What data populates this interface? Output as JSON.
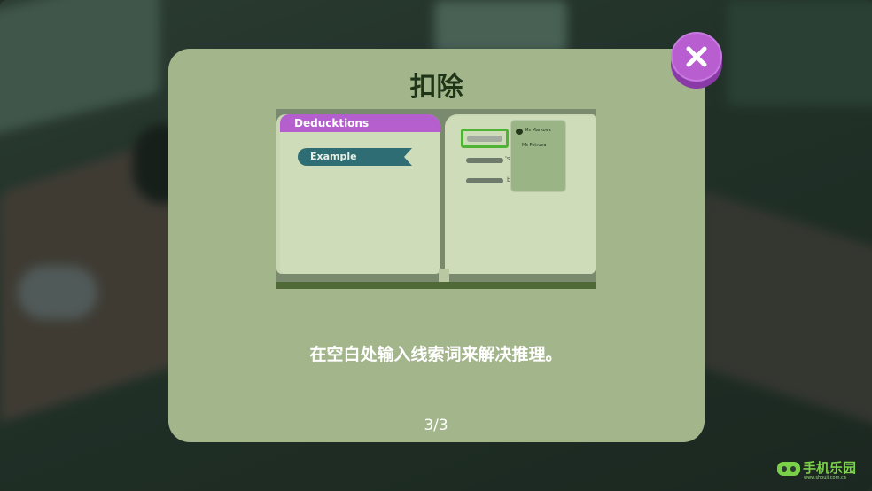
{
  "dialog": {
    "title": "扣除",
    "instruction": "在空白处输入线索词来解决推理。",
    "page_indicator": "3/3"
  },
  "preview": {
    "book_header": "Deducktions",
    "ribbon_label": "Example",
    "popup_names": [
      "Ms Markova",
      "Ms Petrova"
    ]
  },
  "watermark": {
    "text": "手机乐园",
    "subtext": "www.shouji.com.cn"
  },
  "colors": {
    "panel": "#a3b58b",
    "close_button": "#b95ed1",
    "title_text": "#1f3518",
    "book_header": "#b55fcf",
    "ribbon": "#2e6d73",
    "highlight_frame": "#4fb336"
  }
}
